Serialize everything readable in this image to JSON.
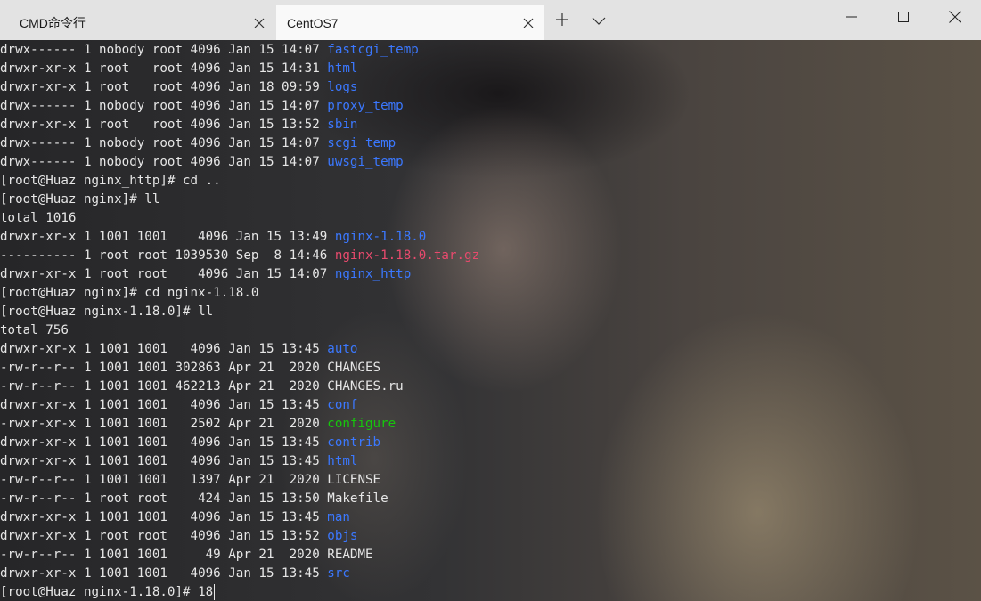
{
  "tabs": [
    {
      "label": "CMD命令行",
      "active": false
    },
    {
      "label": "CentOS7",
      "active": true
    }
  ],
  "icons": {
    "tab_close": "close-icon",
    "new_tab": "plus-icon",
    "tab_dropdown": "chevron-down-icon",
    "minimize": "minimize-icon",
    "maximize": "maximize-icon",
    "close_window": "close-icon"
  },
  "colors": {
    "directory": "#3b78ff",
    "archive": "#e84a6d",
    "executable": "#16c60c",
    "text": "#e6e6e6"
  },
  "terminal": {
    "lines": [
      {
        "text": "drwx------ 1 nobody root 4096 Jan 15 14:07 ",
        "name": "fastcgi_temp",
        "kind": "dir"
      },
      {
        "text": "drwxr-xr-x 1 root   root 4096 Jan 15 14:31 ",
        "name": "html",
        "kind": "dir"
      },
      {
        "text": "drwxr-xr-x 1 root   root 4096 Jan 18 09:59 ",
        "name": "logs",
        "kind": "dir"
      },
      {
        "text": "drwx------ 1 nobody root 4096 Jan 15 14:07 ",
        "name": "proxy_temp",
        "kind": "dir"
      },
      {
        "text": "drwxr-xr-x 1 root   root 4096 Jan 15 13:52 ",
        "name": "sbin",
        "kind": "dir"
      },
      {
        "text": "drwx------ 1 nobody root 4096 Jan 15 14:07 ",
        "name": "scgi_temp",
        "kind": "dir"
      },
      {
        "text": "drwx------ 1 nobody root 4096 Jan 15 14:07 ",
        "name": "uwsgi_temp",
        "kind": "dir"
      },
      {
        "text": "[root@Huaz nginx_http]# cd ..",
        "name": "",
        "kind": "plain"
      },
      {
        "text": "[root@Huaz nginx]# ll",
        "name": "",
        "kind": "plain"
      },
      {
        "text": "total 1016",
        "name": "",
        "kind": "plain"
      },
      {
        "text": "drwxr-xr-x 1 1001 1001    4096 Jan 15 13:49 ",
        "name": "nginx-1.18.0",
        "kind": "dir"
      },
      {
        "text": "---------- 1 root root 1039530 Sep  8 14:46 ",
        "name": "nginx-1.18.0.tar.gz",
        "kind": "arc"
      },
      {
        "text": "drwxr-xr-x 1 root root    4096 Jan 15 14:07 ",
        "name": "nginx_http",
        "kind": "dir"
      },
      {
        "text": "[root@Huaz nginx]# cd nginx-1.18.0",
        "name": "",
        "kind": "plain"
      },
      {
        "text": "[root@Huaz nginx-1.18.0]# ll",
        "name": "",
        "kind": "plain"
      },
      {
        "text": "total 756",
        "name": "",
        "kind": "plain"
      },
      {
        "text": "drwxr-xr-x 1 1001 1001   4096 Jan 15 13:45 ",
        "name": "auto",
        "kind": "dir"
      },
      {
        "text": "-rw-r--r-- 1 1001 1001 302863 Apr 21  2020 ",
        "name": "CHANGES",
        "kind": "file"
      },
      {
        "text": "-rw-r--r-- 1 1001 1001 462213 Apr 21  2020 ",
        "name": "CHANGES.ru",
        "kind": "file"
      },
      {
        "text": "drwxr-xr-x 1 1001 1001   4096 Jan 15 13:45 ",
        "name": "conf",
        "kind": "dir"
      },
      {
        "text": "-rwxr-xr-x 1 1001 1001   2502 Apr 21  2020 ",
        "name": "configure",
        "kind": "exe"
      },
      {
        "text": "drwxr-xr-x 1 1001 1001   4096 Jan 15 13:45 ",
        "name": "contrib",
        "kind": "dir"
      },
      {
        "text": "drwxr-xr-x 1 1001 1001   4096 Jan 15 13:45 ",
        "name": "html",
        "kind": "dir"
      },
      {
        "text": "-rw-r--r-- 1 1001 1001   1397 Apr 21  2020 ",
        "name": "LICENSE",
        "kind": "file"
      },
      {
        "text": "-rw-r--r-- 1 root root    424 Jan 15 13:50 ",
        "name": "Makefile",
        "kind": "file"
      },
      {
        "text": "drwxr-xr-x 1 1001 1001   4096 Jan 15 13:45 ",
        "name": "man",
        "kind": "dir"
      },
      {
        "text": "drwxr-xr-x 1 root root   4096 Jan 15 13:52 ",
        "name": "objs",
        "kind": "dir"
      },
      {
        "text": "-rw-r--r-- 1 1001 1001     49 Apr 21  2020 ",
        "name": "README",
        "kind": "file"
      },
      {
        "text": "drwxr-xr-x 1 1001 1001   4096 Jan 15 13:45 ",
        "name": "src",
        "kind": "dir"
      },
      {
        "text": "[root@Huaz nginx-1.18.0]# 18",
        "name": "",
        "kind": "prompt"
      }
    ]
  }
}
